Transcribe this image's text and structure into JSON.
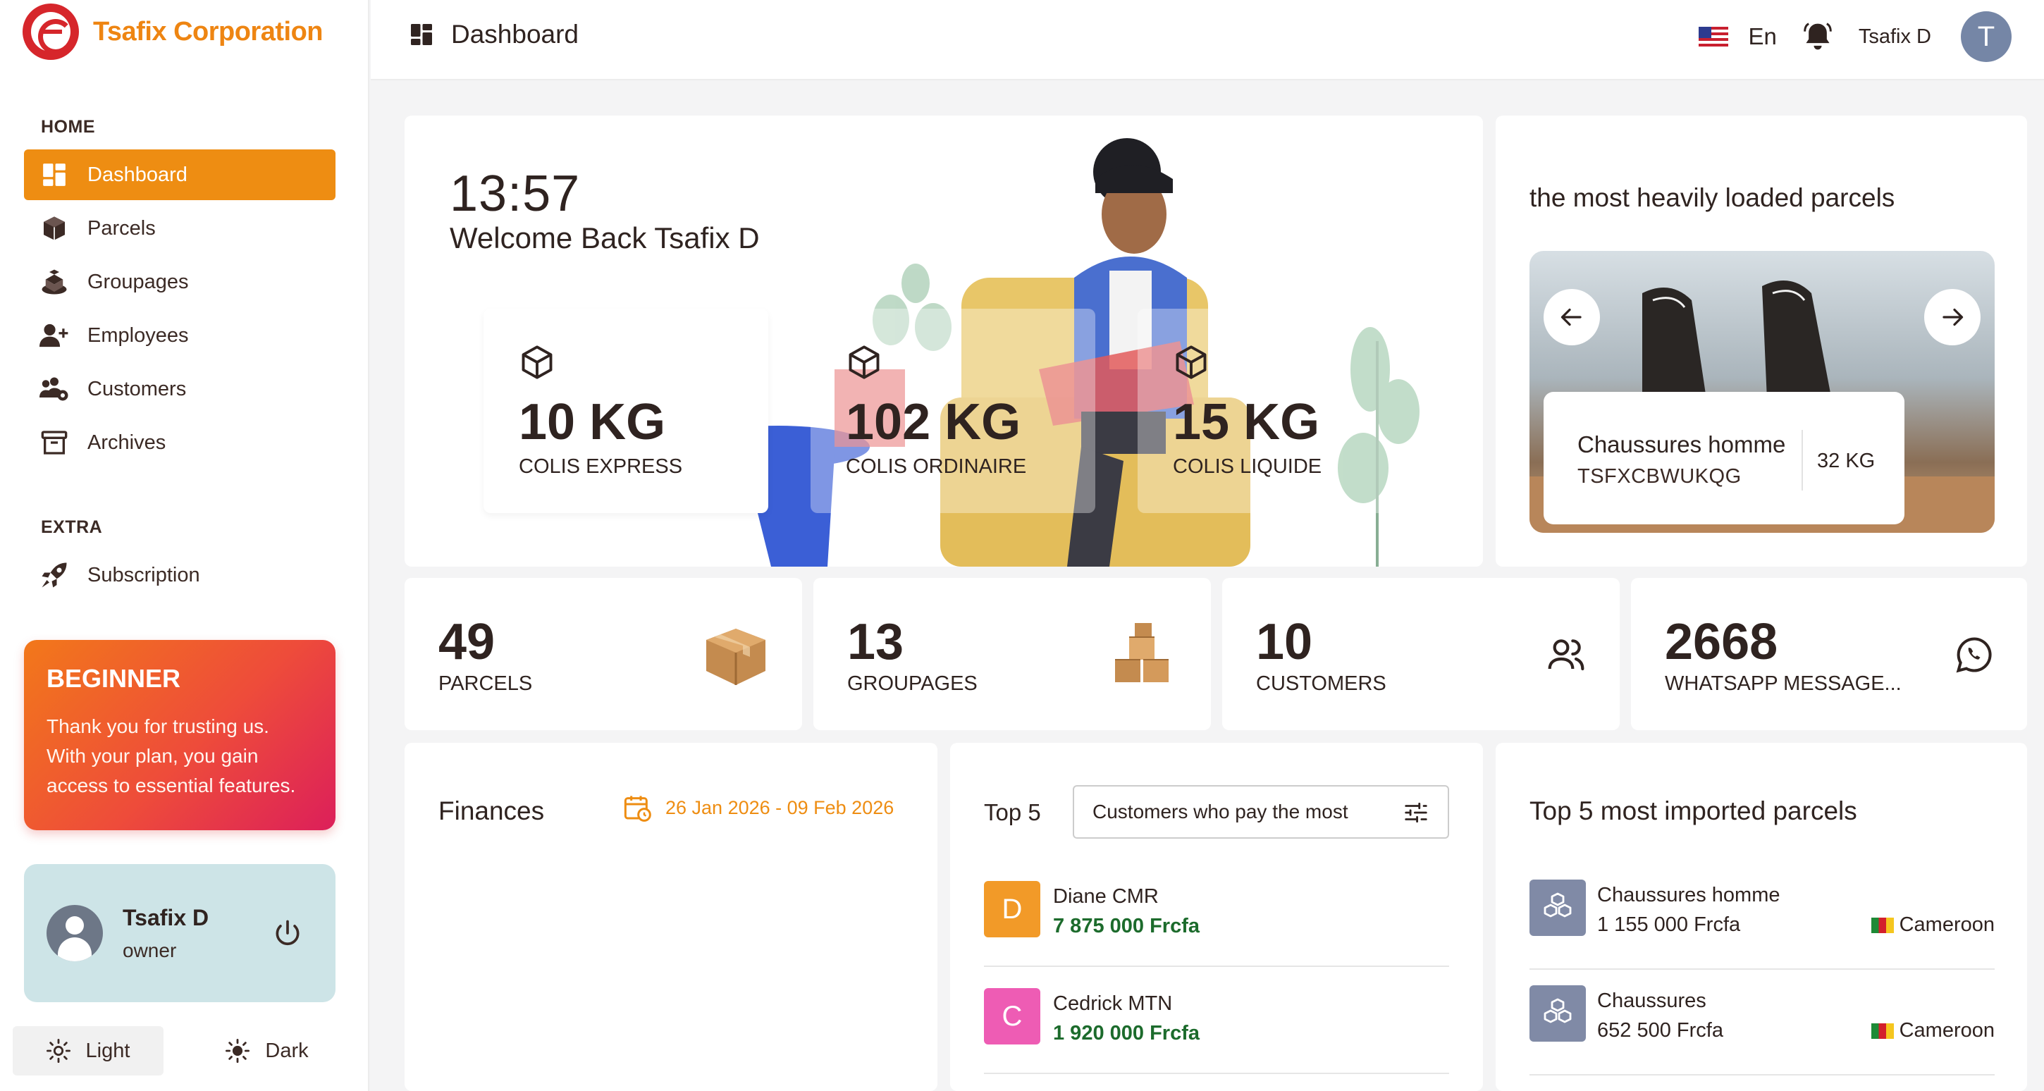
{
  "brand": {
    "name": "Tsafix Corporation",
    "logo_color": "#d6262b",
    "accent_color": "#ee8d12"
  },
  "sidebar": {
    "home_title": "HOME",
    "extra_title": "EXTRA",
    "items": [
      {
        "label": "Dashboard",
        "icon": "dashboard-icon",
        "active": true
      },
      {
        "label": "Parcels",
        "icon": "box-icon"
      },
      {
        "label": "Groupages",
        "icon": "groupage-icon"
      },
      {
        "label": "Employees",
        "icon": "user-add-icon"
      },
      {
        "label": "Customers",
        "icon": "users-gear-icon"
      },
      {
        "label": "Archives",
        "icon": "archive-icon"
      }
    ],
    "extra_items": [
      {
        "label": "Subscription",
        "icon": "rocket-icon"
      }
    ],
    "plan": {
      "title": "BEGINNER",
      "text": "Thank you for trusting us. With your plan, you gain access to essential features."
    },
    "user": {
      "name": "Tsafix D",
      "role": "owner"
    },
    "theme": {
      "light_label": "Light",
      "dark_label": "Dark"
    }
  },
  "header": {
    "title": "Dashboard",
    "language": "En",
    "user_name": "Tsafix D",
    "avatar_initial": "T"
  },
  "welcome": {
    "time": "13:57",
    "message": "Welcome Back Tsafix D",
    "weights": [
      {
        "value": "10 KG",
        "label": "COLIS EXPRESS"
      },
      {
        "value": "102 KG",
        "label": "COLIS ORDINAIRE"
      },
      {
        "value": "15 KG",
        "label": "COLIS LIQUIDE"
      }
    ]
  },
  "heavy_parcels": {
    "title": "the most heavily loaded parcels",
    "item": {
      "name": "Chaussures homme",
      "code": "TSFXCBWUKQG",
      "weight": "32 KG"
    }
  },
  "stats": [
    {
      "value": "49",
      "label": "PARCELS",
      "icon": "cardboard-box-icon"
    },
    {
      "value": "13",
      "label": "GROUPAGES",
      "icon": "stacked-boxes-icon"
    },
    {
      "value": "10",
      "label": "CUSTOMERS",
      "icon": "users-icon"
    },
    {
      "value": "2668",
      "label": "WHATSAPP MESSAGE...",
      "icon": "whatsapp-icon"
    }
  ],
  "finances": {
    "title": "Finances",
    "date_range": "26 Jan 2026 - 09 Feb 2026"
  },
  "top5": {
    "title": "Top 5",
    "filter": "Customers who pay the most",
    "customers": [
      {
        "initial": "D",
        "name": "Diane CMR",
        "amount": "7 875 000 Frcfa",
        "color": "#f29a28"
      },
      {
        "initial": "C",
        "name": "Cedrick MTN",
        "amount": "1 920 000 Frcfa",
        "color": "#ee5cb4"
      }
    ]
  },
  "top_imported": {
    "title": "Top 5 most imported parcels",
    "items": [
      {
        "name": "Chaussures homme",
        "amount": "1 155 000 Frcfa",
        "country": "Cameroon"
      },
      {
        "name": "Chaussures",
        "amount": "652 500 Frcfa",
        "country": "Cameroon"
      }
    ]
  }
}
